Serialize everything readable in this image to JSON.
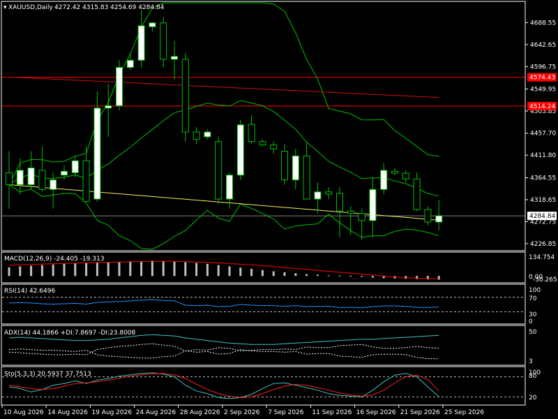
{
  "header": {
    "symbol": "XAUUSD,Daily",
    "ohlc": "4272.42 4315.83 4254.69 4284.84"
  },
  "colors": {
    "background": "#000000",
    "frame": "#ffffff",
    "bull_candle": "#ffffff",
    "bear_candle": "#000000",
    "candle_wick": "#00c000",
    "bollinger": "#00c000",
    "ma_red": "#d01010",
    "ma_yellow": "#f0f060",
    "level_line": "#ff0000",
    "price_line": "#808080",
    "macd_hist": "#c0c0c0",
    "signal_red": "#ff0000",
    "rsi_line": "#1e90ff",
    "adx_line": "#40c0c0",
    "stoch_main": "#40c0c0",
    "stoch_signal": "#ff2020",
    "level_dash": "#c0c0c0"
  },
  "price_axis": {
    "ticks": [
      "4688.55",
      "4642.65",
      "4596.75",
      "4549.95",
      "4503.85",
      "4457.70",
      "4411.80",
      "4364.55",
      "4318.65",
      "4272.75",
      "4226.85"
    ],
    "current_price": "4284.84",
    "level_labels": [
      "4574.43",
      "4514.24"
    ],
    "range": [
      4215,
      4730
    ]
  },
  "indicators": {
    "macd": {
      "label": "MACD(12,26,9) -24.405 -19.313",
      "scale_top": "134.754",
      "scale_mid": "0.00",
      "scale_bottom": "-30.265",
      "range": [
        -35,
        140
      ]
    },
    "rsi": {
      "label": "RSI(14) 42.6496",
      "levels": [
        "100",
        "70",
        "30",
        "0"
      ],
      "range": [
        0,
        100
      ]
    },
    "adx": {
      "label": "ADX(14) 44.1866 +DI:7.8697 -DI:23.8008",
      "scale_top": "50",
      "scale_bottom": "3",
      "range": [
        0,
        55
      ]
    },
    "stoch": {
      "label": "Sto(5,3,3) 20.5937 37.7513",
      "scale_top": "80",
      "scale_mid": "100",
      "scale_bottom": "20",
      "range": [
        0,
        100
      ]
    }
  },
  "time_axis": {
    "labels": [
      "10 Aug 2026",
      "14 Aug 2026",
      "19 Aug 2026",
      "24 Aug 2026",
      "28 Aug 2026",
      "2 Sep 2026",
      "7 Sep 2026",
      "11 Sep 2026",
      "16 Sep 2026",
      "21 Sep 2026",
      "25 Sep 2026"
    ],
    "label_bar_index": [
      0,
      4,
      8,
      12,
      16,
      20,
      24,
      28,
      32,
      36,
      40
    ]
  },
  "chart_data": [
    {
      "type": "candlestick",
      "name_label": "XAUUSD,Daily",
      "ylim": [
        4215,
        4730
      ],
      "horizontal_levels": [
        4574.43,
        4514.24,
        4284.84
      ],
      "candles": [
        {
          "o": 4375,
          "h": 4420,
          "l": 4300,
          "c": 4350
        },
        {
          "o": 4350,
          "h": 4405,
          "l": 4330,
          "c": 4380
        },
        {
          "o": 4350,
          "h": 4420,
          "l": 4340,
          "c": 4385
        },
        {
          "o": 4380,
          "h": 4430,
          "l": 4335,
          "c": 4340
        },
        {
          "o": 4340,
          "h": 4375,
          "l": 4300,
          "c": 4360
        },
        {
          "o": 4370,
          "h": 4390,
          "l": 4360,
          "c": 4378
        },
        {
          "o": 4375,
          "h": 4410,
          "l": 4365,
          "c": 4400
        },
        {
          "o": 4400,
          "h": 4430,
          "l": 4330,
          "c": 4315
        },
        {
          "o": 4320,
          "h": 4545,
          "l": 4315,
          "c": 4510
        },
        {
          "o": 4510,
          "h": 4560,
          "l": 4450,
          "c": 4515
        },
        {
          "o": 4515,
          "h": 4610,
          "l": 4505,
          "c": 4595
        },
        {
          "o": 4595,
          "h": 4625,
          "l": 4590,
          "c": 4610
        },
        {
          "o": 4610,
          "h": 4715,
          "l": 4595,
          "c": 4682
        },
        {
          "o": 4680,
          "h": 4690,
          "l": 4670,
          "c": 4688
        },
        {
          "o": 4688,
          "h": 4700,
          "l": 4595,
          "c": 4612
        },
        {
          "o": 4612,
          "h": 4650,
          "l": 4570,
          "c": 4618
        },
        {
          "o": 4612,
          "h": 4625,
          "l": 4440,
          "c": 4460
        },
        {
          "o": 4460,
          "h": 4470,
          "l": 4435,
          "c": 4445
        },
        {
          "o": 4450,
          "h": 4465,
          "l": 4445,
          "c": 4460
        },
        {
          "o": 4440,
          "h": 4450,
          "l": 4310,
          "c": 4320
        },
        {
          "o": 4320,
          "h": 4375,
          "l": 4300,
          "c": 4370
        },
        {
          "o": 4370,
          "h": 4485,
          "l": 4360,
          "c": 4475
        },
        {
          "o": 4476,
          "h": 4495,
          "l": 4435,
          "c": 4440
        },
        {
          "o": 4440,
          "h": 4445,
          "l": 4430,
          "c": 4433
        },
        {
          "o": 4433,
          "h": 4440,
          "l": 4415,
          "c": 4425
        },
        {
          "o": 4420,
          "h": 4435,
          "l": 4350,
          "c": 4360
        },
        {
          "o": 4360,
          "h": 4425,
          "l": 4340,
          "c": 4410
        },
        {
          "o": 4410,
          "h": 4440,
          "l": 4325,
          "c": 4320
        },
        {
          "o": 4320,
          "h": 4355,
          "l": 4290,
          "c": 4335
        },
        {
          "o": 4335,
          "h": 4345,
          "l": 4320,
          "c": 4330
        },
        {
          "o": 4332,
          "h": 4345,
          "l": 4240,
          "c": 4295
        },
        {
          "o": 4295,
          "h": 4305,
          "l": 4245,
          "c": 4290
        },
        {
          "o": 4290,
          "h": 4300,
          "l": 4235,
          "c": 4275
        },
        {
          "o": 4275,
          "h": 4365,
          "l": 4240,
          "c": 4340
        },
        {
          "o": 4340,
          "h": 4395,
          "l": 4330,
          "c": 4380
        },
        {
          "o": 4378,
          "h": 4385,
          "l": 4370,
          "c": 4374
        },
        {
          "o": 4374,
          "h": 4380,
          "l": 4355,
          "c": 4362
        },
        {
          "o": 4362,
          "h": 4375,
          "l": 4295,
          "c": 4298
        },
        {
          "o": 4298,
          "h": 4305,
          "l": 4265,
          "c": 4272
        },
        {
          "o": 4272,
          "h": 4318,
          "l": 4254,
          "c": 4285
        }
      ]
    },
    {
      "type": "bar",
      "name_label": "MACD(12,26,9)",
      "values": [
        56,
        62,
        66,
        70,
        74,
        78,
        82,
        84,
        86,
        88,
        90,
        92,
        95,
        98,
        96,
        92,
        88,
        84,
        78,
        70,
        62,
        54,
        46,
        38,
        30,
        24,
        18,
        12,
        8,
        4,
        2,
        -2,
        -6,
        -10,
        -14,
        -16,
        -18,
        -20,
        -22,
        -24
      ],
      "signal": [
        70,
        72,
        74,
        76,
        78,
        80,
        82,
        84,
        86,
        88,
        90,
        92,
        93,
        94,
        95,
        94,
        92,
        90,
        87,
        84,
        80,
        76,
        72,
        66,
        60,
        54,
        48,
        42,
        36,
        30,
        24,
        18,
        12,
        6,
        0,
        -6,
        -12,
        -15,
        -17,
        -19
      ]
    },
    {
      "type": "line",
      "name_label": "RSI(14)",
      "values": [
        54,
        55,
        54,
        52,
        51,
        52,
        53,
        51,
        56,
        57,
        58,
        60,
        62,
        63,
        61,
        60,
        48,
        47,
        48,
        44,
        45,
        50,
        48,
        47,
        47,
        45,
        47,
        44,
        45,
        45,
        42,
        42,
        41,
        44,
        46,
        46,
        45,
        42,
        42,
        43
      ],
      "levels": [
        70,
        30
      ]
    },
    {
      "type": "line",
      "name_label": "ADX(14)",
      "series": [
        {
          "name_label": "ADX",
          "values": [
            40,
            41,
            40,
            39,
            38,
            37,
            36,
            36,
            37,
            38,
            40,
            42,
            44,
            45,
            44,
            43,
            40,
            38,
            36,
            34,
            32,
            31,
            30,
            30,
            30,
            31,
            32,
            33,
            34,
            35,
            36,
            37,
            38,
            38,
            39,
            40,
            41,
            42,
            43,
            44
          ]
        },
        {
          "name_label": "+DI",
          "values": [
            18,
            17,
            16,
            15,
            14,
            14,
            15,
            14,
            22,
            25,
            27,
            28,
            30,
            31,
            29,
            27,
            20,
            18,
            19,
            15,
            16,
            22,
            20,
            19,
            19,
            18,
            19,
            15,
            16,
            16,
            12,
            11,
            10,
            14,
            15,
            15,
            14,
            10,
            8,
            8
          ]
        },
        {
          "name_label": "-DI",
          "values": [
            22,
            23,
            22,
            21,
            21,
            20,
            19,
            21,
            14,
            12,
            11,
            10,
            9,
            9,
            11,
            12,
            20,
            22,
            21,
            25,
            24,
            20,
            21,
            22,
            22,
            23,
            22,
            26,
            25,
            25,
            28,
            29,
            30,
            26,
            24,
            24,
            25,
            27,
            25,
            24
          ]
        }
      ]
    },
    {
      "type": "line",
      "name_label": "Sto(5,3,3)",
      "series": [
        {
          "name_label": "%K",
          "values": [
            50,
            45,
            35,
            42,
            55,
            60,
            68,
            60,
            70,
            75,
            82,
            86,
            90,
            92,
            88,
            80,
            55,
            38,
            30,
            18,
            15,
            18,
            28,
            45,
            60,
            62,
            55,
            48,
            40,
            30,
            25,
            22,
            20,
            40,
            65,
            85,
            90,
            80,
            50,
            21
          ]
        },
        {
          "name_label": "%D",
          "values": [
            55,
            50,
            45,
            42,
            45,
            52,
            60,
            62,
            65,
            70,
            76,
            82,
            86,
            89,
            90,
            86,
            75,
            58,
            42,
            30,
            22,
            18,
            20,
            30,
            42,
            52,
            58,
            55,
            48,
            40,
            32,
            26,
            22,
            26,
            40,
            62,
            80,
            85,
            72,
            38
          ]
        }
      ],
      "levels": [
        80,
        20
      ]
    }
  ]
}
